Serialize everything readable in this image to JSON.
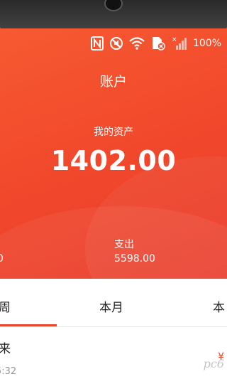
{
  "status_bar": {
    "battery": "100%"
  },
  "header": {
    "title": "账户"
  },
  "assets": {
    "label": "我的资产",
    "value": "1402.00"
  },
  "summary": {
    "left_value": "0",
    "expense_label": "支出",
    "expense_value": "5598.00"
  },
  "tabs": [
    {
      "label": "周"
    },
    {
      "label": "本月"
    },
    {
      "label": "本"
    }
  ],
  "record": {
    "title": "来",
    "time": "5:32",
    "currency": "¥"
  },
  "watermark": "pc6",
  "colors": {
    "accent": "#e8442e",
    "hero": "#f24a2c"
  }
}
